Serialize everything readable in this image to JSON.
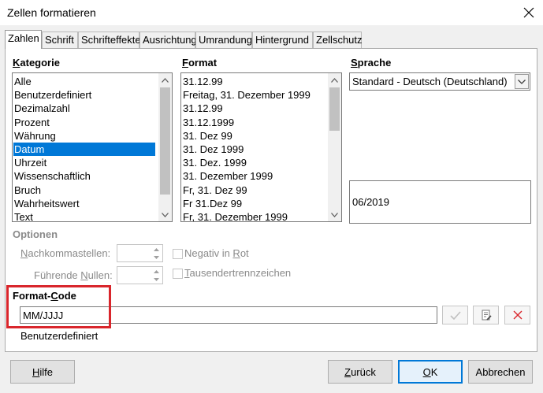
{
  "window": {
    "title": "Zellen formatieren"
  },
  "tabs": [
    {
      "label": "Zahlen"
    },
    {
      "label": "Schrift"
    },
    {
      "label": "Schrifteffekte"
    },
    {
      "label": "Ausrichtung"
    },
    {
      "label": "Umrandung"
    },
    {
      "label": "Hintergrund"
    },
    {
      "label": "Zellschutz"
    }
  ],
  "kategorie": {
    "header_pre": "",
    "header_u": "K",
    "header_post": "ategorie",
    "items": [
      "Alle",
      "Benutzerdefiniert",
      "Dezimalzahl",
      "Prozent",
      "Währung",
      "Datum",
      "Uhrzeit",
      "Wissenschaftlich",
      "Bruch",
      "Wahrheitswert",
      "Text"
    ],
    "selected": "Datum"
  },
  "format": {
    "header_pre": "",
    "header_u": "F",
    "header_post": "ormat",
    "items": [
      "31.12.99",
      "Freitag, 31. Dezember 1999",
      "31.12.99",
      "31.12.1999",
      "31. Dez 99",
      "31. Dez 1999",
      "31. Dez. 1999",
      "31. Dezember 1999",
      "Fr, 31. Dez 99",
      "Fr 31.Dez 99",
      "Fr, 31. Dezember 1999"
    ]
  },
  "sprache": {
    "header_pre": "",
    "header_u": "S",
    "header_post": "prache",
    "value": "Standard - Deutsch (Deutschland)",
    "preview": "06/2019"
  },
  "optionen": {
    "header": "Optionen",
    "nachkomma_pre": "",
    "nachkomma_u": "N",
    "nachkomma_post": "achkommastellen:",
    "fuehrende_pre": "Führende ",
    "fuehrende_u": "N",
    "fuehrende_post": "ullen:",
    "negativ_pre": "Negativ in ",
    "negativ_u": "R",
    "negativ_post": "ot",
    "tausender_pre": "",
    "tausender_u": "T",
    "tausender_post": "ausendertrennzeichen"
  },
  "formatcode": {
    "header_pre": "Format-",
    "header_u": "C",
    "header_post": "ode",
    "value": "MM/JJJJ",
    "description": "Benutzerdefiniert"
  },
  "buttons": {
    "hilfe_u": "H",
    "hilfe_post": "ilfe",
    "zurueck_u": "Z",
    "zurueck_post": "urück",
    "ok_u": "O",
    "ok_post": "K",
    "abbrechen": "Abbrechen"
  },
  "colors": {
    "selection": "#0078d7",
    "highlight": "#d9262c",
    "default_border": "#0078d7"
  }
}
